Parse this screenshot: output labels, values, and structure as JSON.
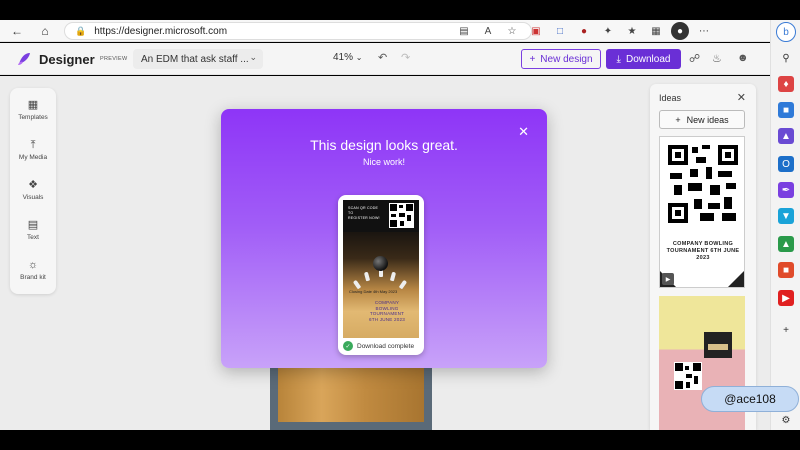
{
  "browser": {
    "url_host": "https://designer.microsoft.com",
    "back_icon": "back-arrow-icon",
    "home_icon": "home-icon"
  },
  "app": {
    "brand": "Designer",
    "preview_tag": "PREVIEW",
    "doc_title": "An EDM that ask staff ...",
    "zoom": "41%",
    "new_design_label": "New design",
    "download_label": "Download",
    "accent_color": "#6a2fd6"
  },
  "left_rail": {
    "items": [
      {
        "label": "Templates",
        "icon": "templates-icon"
      },
      {
        "label": "My Media",
        "icon": "upload-icon"
      },
      {
        "label": "Visuals",
        "icon": "visuals-icon"
      },
      {
        "label": "Text",
        "icon": "text-icon"
      },
      {
        "label": "Brand kit",
        "icon": "brand-kit-icon"
      }
    ]
  },
  "ideas": {
    "title": "Ideas",
    "new_ideas_label": "New ideas",
    "card1_text": "COMPANY BOWLING TOURNAMENT 6TH JUNE 2023"
  },
  "modal": {
    "heading": "This design looks great.",
    "subheading": "Nice work!",
    "download_status": "Download complete",
    "poster": {
      "scan_text_1": "SCAN QR CODE",
      "scan_text_2": "TO",
      "scan_text_3": "REGISTER NOW!",
      "closing_date": "Closing Date 4th May 2023",
      "company_1": "COMPANY",
      "company_2": "BOWLING",
      "company_3": "TOURNAMENT",
      "company_4": "6TH JUNE 2023"
    }
  },
  "watermark": "@ace108"
}
